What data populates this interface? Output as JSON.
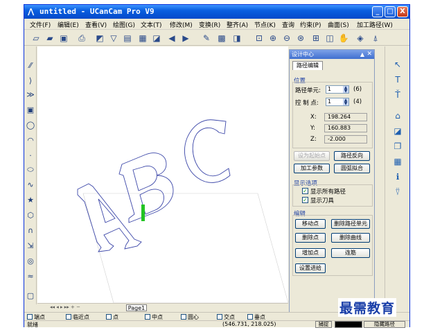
{
  "window": {
    "title": "untitled - UCanCam Pro V9",
    "minimize": "_",
    "maximize": "□",
    "close": "X"
  },
  "menu": [
    "文件(F)",
    "编辑(E)",
    "查看(V)",
    "绘图(G)",
    "文本(T)",
    "修改(M)",
    "变换(R)",
    "整齐(A)",
    "节点(K)",
    "查询",
    "约束(P)",
    "曲面(S)",
    "加工路径(W)"
  ],
  "toolbar_icons": [
    "new-file",
    "open-folder",
    "save",
    "print",
    "cut",
    "copy",
    "paste",
    "layers",
    "align",
    "undo",
    "redo",
    "pointer-node",
    "grid",
    "design",
    "zoom-window",
    "zoom-in",
    "zoom-out",
    "zoom-fit",
    "zoom-page",
    "pan-hand",
    "view-3d",
    "toolpath"
  ],
  "canvas": {
    "text": "ABC",
    "page_tab": "Page1"
  },
  "panel": {
    "title": "设计中心",
    "pin": "▲",
    "close": "✕",
    "tab": "路径编辑",
    "position": {
      "title": "位置",
      "path_unit_label": "路径单元:",
      "path_unit_value": "1",
      "path_unit_count": "(6)",
      "control_point_label": "控 制 点:",
      "control_point_value": "1",
      "control_point_count": "(4)",
      "x_label": "X:",
      "x_value": "198.264",
      "y_label": "Y:",
      "y_value": "160.883",
      "z_label": "Z:",
      "z_value": "-2.000"
    },
    "buttons_top": {
      "set_start": "设为起始点",
      "reverse_path": "路径反向",
      "machining_params": "加工参数",
      "arc_fit": "圆弧拟合"
    },
    "display": {
      "title": "显示选项",
      "show_all_paths": "显示所有路径",
      "show_tool": "显示刀具",
      "show_all_paths_checked": true,
      "show_tool_checked": true
    },
    "edit": {
      "title": "编辑",
      "move_point": "移动点",
      "delete_path_unit": "删除路径单元",
      "delete_point": "删除点",
      "delete_curve": "删除曲线",
      "add_point": "增加点",
      "connect": "连筋",
      "set_entry": "设置进给"
    }
  },
  "snap": [
    "端点",
    "临近点",
    "点",
    "中点",
    "圆心",
    "交点",
    "垂点"
  ],
  "status": {
    "text": "就绪",
    "coords": "(546.731,  218.025)",
    "snap_btn": "捕捉",
    "color_label": "隐藏路径"
  },
  "watermark": "最需教育"
}
